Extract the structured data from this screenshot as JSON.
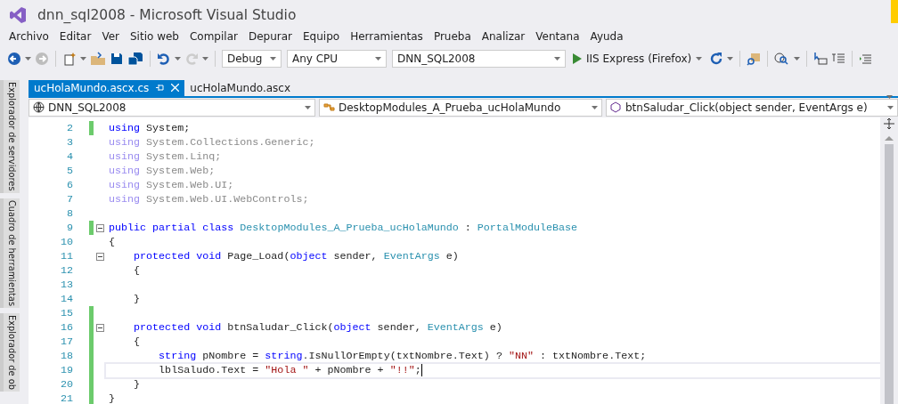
{
  "window": {
    "title": "dnn_sql2008 - Microsoft Visual Studio"
  },
  "menu": [
    "Archivo",
    "Editar",
    "Ver",
    "Sitio web",
    "Compilar",
    "Depurar",
    "Equipo",
    "Herramientas",
    "Prueba",
    "Analizar",
    "Ventana",
    "Ayuda"
  ],
  "toolbar": {
    "configuration": "Debug",
    "platform": "Any CPU",
    "project": "DNN_SQL2008",
    "run": "IIS Express (Firefox)"
  },
  "side_tabs": [
    "Explorador de servidores",
    "Cuadro de herramientas",
    "Explorador de ob"
  ],
  "tabs": [
    {
      "label": "ucHolaMundo.ascx.cs",
      "selected": true
    },
    {
      "label": "ucHolaMundo.ascx",
      "selected": false
    }
  ],
  "nav_bar": {
    "project": "DNN_SQL2008",
    "type": "DesktopModules_A_Prueba_ucHolaMundo",
    "member": "btnSaludar_Click(object sender, EventArgs e)"
  },
  "lines": [
    {
      "number": "2",
      "changed": true,
      "fold": false,
      "current": false,
      "tokens": [
        {
          "kind": "kw",
          "text": "using"
        },
        {
          "kind": "plain",
          "text": " System;"
        }
      ]
    },
    {
      "number": "3",
      "changed": false,
      "fold": false,
      "current": false,
      "tokens": [
        {
          "kind": "unused_kw",
          "text": "using"
        },
        {
          "kind": "unused",
          "text": " System.Collections.Generic;"
        }
      ]
    },
    {
      "number": "4",
      "changed": false,
      "fold": false,
      "current": false,
      "tokens": [
        {
          "kind": "unused_kw",
          "text": "using"
        },
        {
          "kind": "unused",
          "text": " System.Linq;"
        }
      ]
    },
    {
      "number": "5",
      "changed": false,
      "fold": false,
      "current": false,
      "tokens": [
        {
          "kind": "unused_kw",
          "text": "using"
        },
        {
          "kind": "unused",
          "text": " System.Web;"
        }
      ]
    },
    {
      "number": "6",
      "changed": false,
      "fold": false,
      "current": false,
      "tokens": [
        {
          "kind": "unused_kw",
          "text": "using"
        },
        {
          "kind": "unused",
          "text": " System.Web.UI;"
        }
      ]
    },
    {
      "number": "7",
      "changed": false,
      "fold": false,
      "current": false,
      "tokens": [
        {
          "kind": "unused_kw",
          "text": "using"
        },
        {
          "kind": "unused",
          "text": " System.Web.UI.WebControls;"
        }
      ]
    },
    {
      "number": "8",
      "changed": false,
      "fold": false,
      "current": false
    },
    {
      "number": "9",
      "changed": true,
      "fold": true,
      "current": false,
      "tokens": [
        {
          "kind": "kw",
          "text": "public partial class"
        },
        {
          "kind": "type",
          "text": " DesktopModules_A_Prueba_ucHolaMundo"
        },
        {
          "kind": "plain",
          "text": " : "
        },
        {
          "kind": "type",
          "text": "PortalModuleBase"
        }
      ]
    },
    {
      "number": "10",
      "changed": false,
      "fold": false,
      "current": false,
      "tokens": [
        {
          "kind": "plain",
          "text": "{"
        }
      ]
    },
    {
      "number": "11",
      "changed": false,
      "fold": true,
      "current": false,
      "tokens": [
        {
          "kind": "kw",
          "text": "    protected void"
        },
        {
          "kind": "plain",
          "text": " Page_Load("
        },
        {
          "kind": "kw",
          "text": "object"
        },
        {
          "kind": "plain",
          "text": " sender, "
        },
        {
          "kind": "type",
          "text": "EventArgs"
        },
        {
          "kind": "plain",
          "text": " e)"
        }
      ]
    },
    {
      "number": "12",
      "changed": false,
      "fold": false,
      "current": false,
      "tokens": [
        {
          "kind": "plain",
          "text": "    {"
        }
      ]
    },
    {
      "number": "13",
      "changed": false,
      "fold": false,
      "current": false
    },
    {
      "number": "14",
      "changed": false,
      "fold": false,
      "current": false,
      "tokens": [
        {
          "kind": "plain",
          "text": "    }"
        }
      ]
    },
    {
      "number": "15",
      "changed": true,
      "fold": false,
      "current": false
    },
    {
      "number": "16",
      "changed": true,
      "fold": true,
      "current": false,
      "tokens": [
        {
          "kind": "kw",
          "text": "    protected void"
        },
        {
          "kind": "plain",
          "text": " btnSaludar_Click("
        },
        {
          "kind": "kw",
          "text": "object"
        },
        {
          "kind": "plain",
          "text": " sender, "
        },
        {
          "kind": "type",
          "text": "EventArgs"
        },
        {
          "kind": "plain",
          "text": " e)"
        }
      ]
    },
    {
      "number": "17",
      "changed": true,
      "fold": false,
      "current": false,
      "tokens": [
        {
          "kind": "plain",
          "text": "    {"
        }
      ]
    },
    {
      "number": "18",
      "changed": true,
      "fold": false,
      "current": false,
      "tokens": [
        {
          "kind": "kw",
          "text": "        string"
        },
        {
          "kind": "plain",
          "text": " pNombre = "
        },
        {
          "kind": "kw",
          "text": "string"
        },
        {
          "kind": "plain",
          "text": ".IsNullOrEmpty(txtNombre.Text) ? "
        },
        {
          "kind": "str",
          "text": "\"NN\""
        },
        {
          "kind": "plain",
          "text": " : txtNombre.Text;"
        }
      ]
    },
    {
      "number": "19",
      "changed": true,
      "fold": false,
      "current": true,
      "tokens": [
        {
          "kind": "plain",
          "text": "        lblSaludo.Text = "
        },
        {
          "kind": "str",
          "text": "\"Hola \""
        },
        {
          "kind": "plain",
          "text": " + pNombre + "
        },
        {
          "kind": "str",
          "text": "\"!!\""
        },
        {
          "kind": "plain",
          "text": ";"
        }
      ]
    },
    {
      "number": "20",
      "changed": true,
      "fold": false,
      "current": false,
      "tokens": [
        {
          "kind": "plain",
          "text": "    }"
        }
      ]
    },
    {
      "number": "21",
      "changed": true,
      "fold": false,
      "current": false,
      "tokens": [
        {
          "kind": "plain",
          "text": "}"
        }
      ]
    }
  ]
}
